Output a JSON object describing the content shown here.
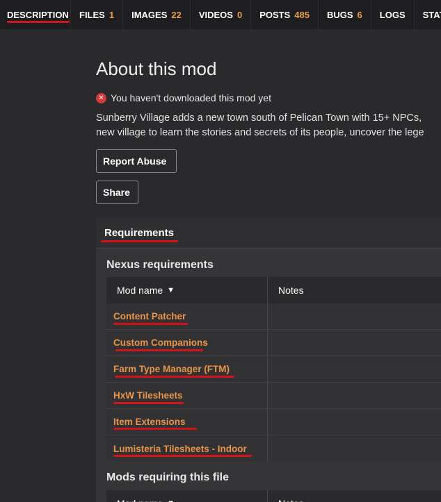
{
  "tabs": [
    {
      "label": "DESCRIPTION",
      "count": ""
    },
    {
      "label": "FILES",
      "count": "1"
    },
    {
      "label": "IMAGES",
      "count": "22"
    },
    {
      "label": "VIDEOS",
      "count": "0"
    },
    {
      "label": "POSTS",
      "count": "485"
    },
    {
      "label": "BUGS",
      "count": "6"
    },
    {
      "label": "LOGS",
      "count": ""
    },
    {
      "label": "STATS",
      "count": ""
    }
  ],
  "page": {
    "title": "About this mod",
    "notice": "You haven't downloaded this mod yet",
    "notice_icon": "error-circle-icon",
    "description_line1": "Sunberry Village adds a new town south of Pelican Town with 15+ NPCs,",
    "description_line2": "new village to learn the stories and secrets of its people, uncover the lege"
  },
  "buttons": {
    "report_abuse": "Report Abuse",
    "share": "Share"
  },
  "requirements": {
    "title": "Requirements",
    "nexus_title": "Nexus requirements",
    "col_mod_name": "Mod name",
    "col_notes": "Notes",
    "nexus_rows": [
      {
        "name": "Content Patcher",
        "notes": ""
      },
      {
        "name": "Custom Companions",
        "notes": ""
      },
      {
        "name": "Farm Type Manager (FTM)",
        "notes": ""
      },
      {
        "name": "HxW Tilesheets",
        "notes": ""
      },
      {
        "name": "Item Extensions",
        "notes": ""
      },
      {
        "name": "Lumisteria Tilesheets - Indoor",
        "notes": ""
      }
    ],
    "requiring_title": "Mods requiring this file"
  },
  "colors": {
    "accent_orange": "#e8944a",
    "underline_red": "#d0151c",
    "background": "#2a2a2d"
  }
}
